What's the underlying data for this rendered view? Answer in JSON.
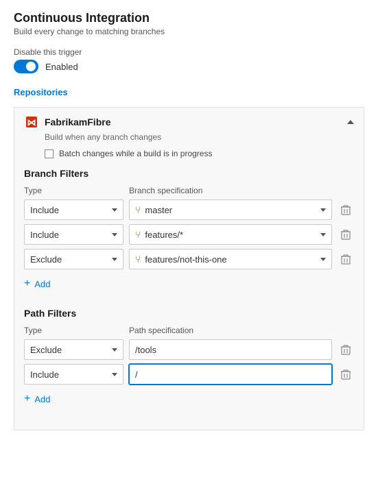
{
  "page": {
    "title": "Continuous Integration",
    "subtitle": "Build every change to matching branches"
  },
  "trigger": {
    "disable_label": "Disable this trigger",
    "toggle_state": "Enabled",
    "enabled": true
  },
  "repositories_heading": "Repositories",
  "repository": {
    "name": "FabrikamFibre",
    "subtitle": "Build when any branch changes",
    "batch_checkbox_label": "Batch changes while a build is in progress"
  },
  "branch_filters": {
    "title": "Branch Filters",
    "type_column": "Type",
    "spec_column": "Branch specification",
    "rows": [
      {
        "type": "Include",
        "spec": "master"
      },
      {
        "type": "Include",
        "spec": "features/*"
      },
      {
        "type": "Exclude",
        "spec": "features/not-this-one"
      }
    ],
    "add_label": "Add"
  },
  "path_filters": {
    "title": "Path Filters",
    "type_column": "Type",
    "spec_column": "Path specification",
    "rows": [
      {
        "type": "Exclude",
        "spec": "/tools",
        "input_mode": false
      },
      {
        "type": "Include",
        "spec": "/",
        "input_mode": true
      }
    ],
    "add_label": "Add"
  },
  "icons": {
    "chevron_down": "▾",
    "chevron_up": "▴",
    "branch": "⑂",
    "delete": "🗑",
    "plus": "+"
  }
}
